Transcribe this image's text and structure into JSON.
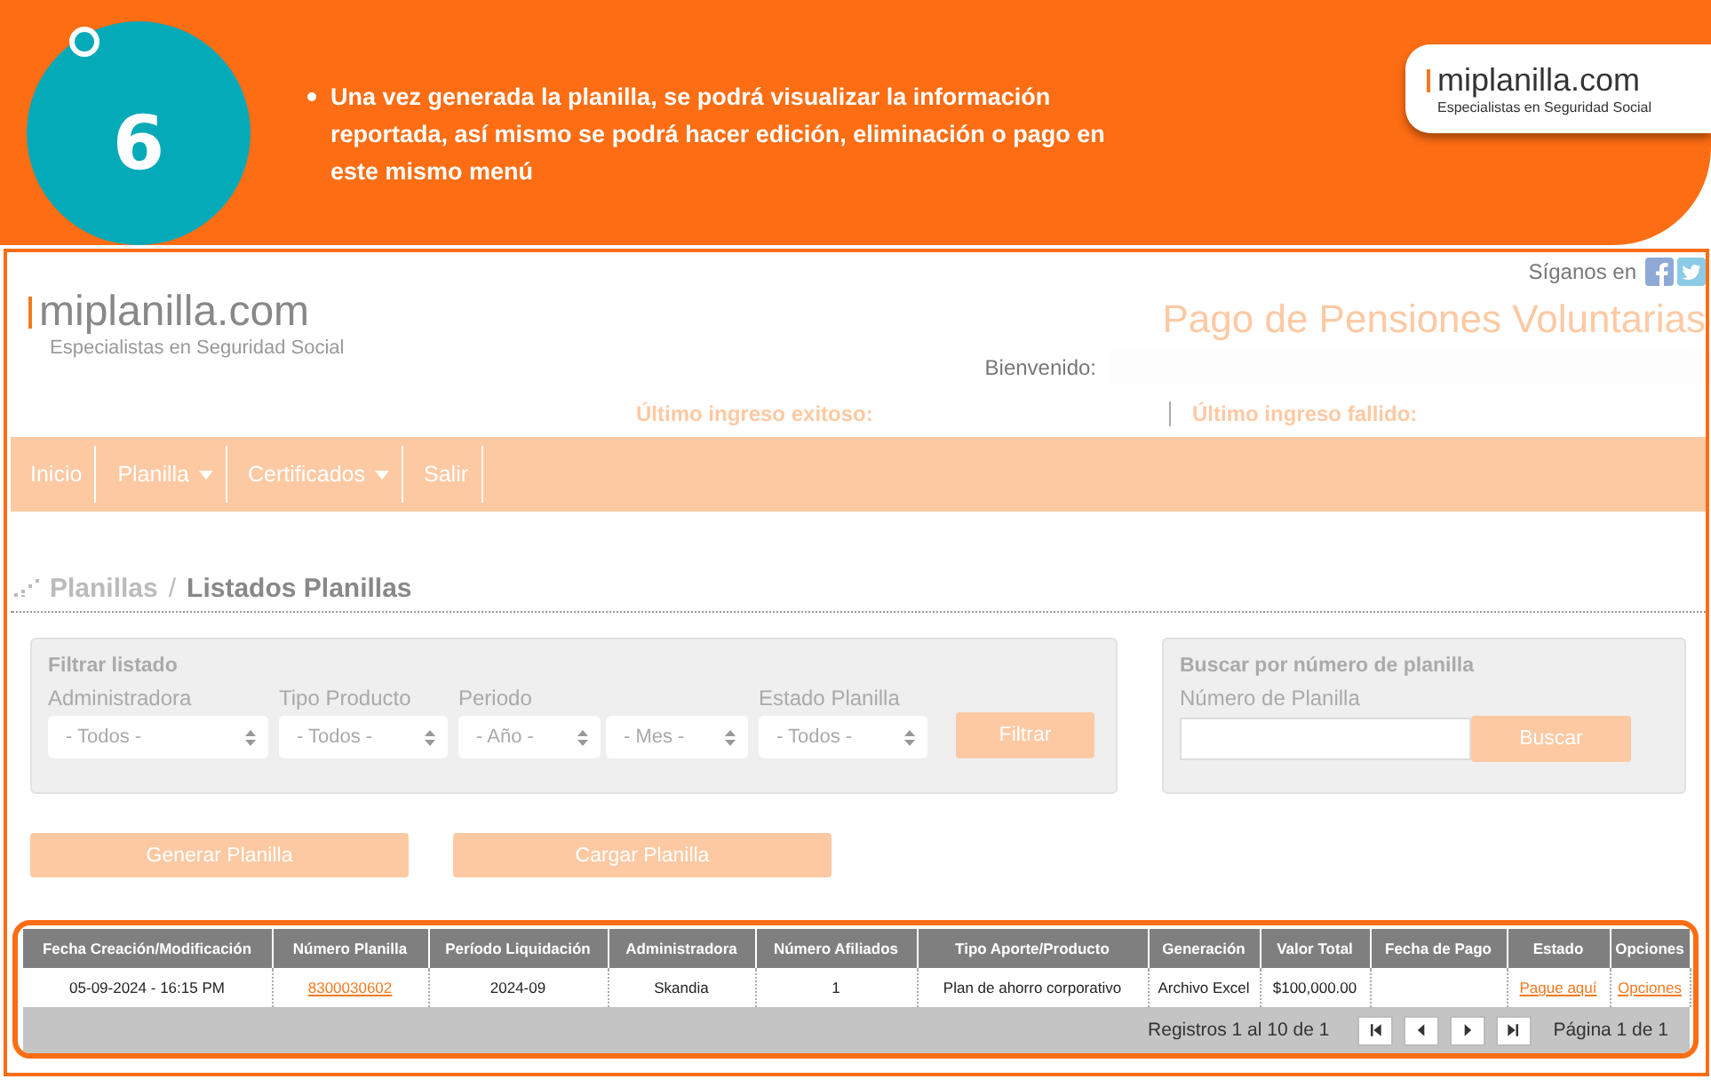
{
  "banner": {
    "step": "6",
    "text": "Una vez generada la planilla, se podrá visualizar la información reportada, así mismo se podrá hacer edición, eliminación o pago en este mismo menú",
    "logo": {
      "name": "miplanilla.com",
      "tagline": "Especialistas en Seguridad Social"
    }
  },
  "header": {
    "logo": {
      "name": "miplanilla.com",
      "tagline": "Especialistas en Seguridad Social"
    },
    "social_label": "Síganos en",
    "title": "Pago de Pensiones Voluntarias",
    "welcome_label": "Bienvenido:",
    "last_success": "Último ingreso exitoso:",
    "last_failed": "Último ingreso fallido:"
  },
  "nav": [
    {
      "label": "Inicio",
      "dropdown": false
    },
    {
      "label": "Planilla",
      "dropdown": true
    },
    {
      "label": "Certificados",
      "dropdown": true
    },
    {
      "label": "Salir",
      "dropdown": false
    }
  ],
  "breadcrumb": {
    "parent": "Planillas",
    "separator": "/",
    "current": "Listados Planillas"
  },
  "filter": {
    "title": "Filtrar listado",
    "fields": [
      {
        "label": "Administradora",
        "selects": [
          "- Todos -"
        ]
      },
      {
        "label": "Tipo Producto",
        "selects": [
          "- Todos -"
        ]
      },
      {
        "label": "Periodo",
        "selects": [
          "- Año -",
          "- Mes -"
        ]
      },
      {
        "label": "Estado Planilla",
        "selects": [
          "- Todos -"
        ]
      }
    ],
    "button": "Filtrar"
  },
  "search": {
    "title": "Buscar por número de planilla",
    "label": "Número de Planilla",
    "button": "Buscar"
  },
  "actions": [
    "Generar Planilla",
    "Cargar Planilla"
  ],
  "table": {
    "columns": [
      "Fecha Creación/Modificación",
      "Número Planilla",
      "Período Liquidación",
      "Administradora",
      "Número Afiliados",
      "Tipo Aporte/Producto",
      "Generación",
      "Valor Total",
      "Fecha de Pago",
      "Estado",
      "Opciones"
    ],
    "rows": [
      [
        {
          "kind": "text",
          "text": "05-09-2024 - 16:15 PM"
        },
        {
          "kind": "link",
          "text": "8300030602"
        },
        {
          "kind": "text",
          "text": "2024-09"
        },
        {
          "kind": "text",
          "text": "Skandia"
        },
        {
          "kind": "text",
          "text": "1"
        },
        {
          "kind": "text",
          "text": "Plan de ahorro corporativo"
        },
        {
          "kind": "text",
          "text": "Archivo Excel"
        },
        {
          "kind": "text",
          "text": "$100,000.00"
        },
        {
          "kind": "empty"
        },
        {
          "kind": "link",
          "text": "Pague aquí"
        },
        {
          "kind": "link",
          "text": "Opciones"
        }
      ]
    ],
    "records": "Registros 1 al 10 de 1",
    "pager": [
      {
        "kind": "first"
      },
      {
        "kind": "prev"
      },
      {
        "kind": "next"
      },
      {
        "kind": "last"
      }
    ],
    "page": "Página 1 de 1"
  }
}
